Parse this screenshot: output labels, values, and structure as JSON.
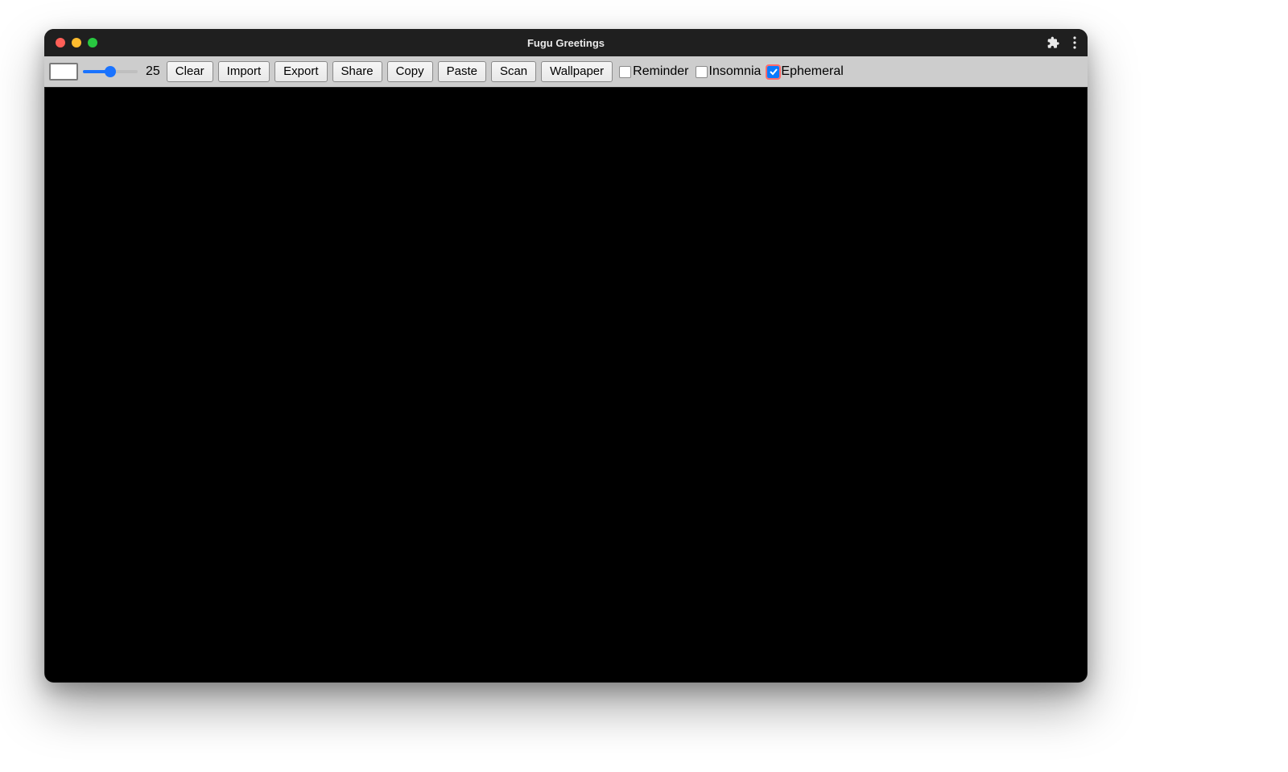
{
  "window": {
    "title": "Fugu Greetings"
  },
  "toolbar": {
    "slider_value": "25",
    "slider_percent": 50,
    "buttons": {
      "clear": "Clear",
      "import": "Import",
      "export": "Export",
      "share": "Share",
      "copy": "Copy",
      "paste": "Paste",
      "scan": "Scan",
      "wallpaper": "Wallpaper"
    },
    "checkboxes": {
      "reminder": {
        "label": "Reminder",
        "checked": false
      },
      "insomnia": {
        "label": "Insomnia",
        "checked": false
      },
      "ephemeral": {
        "label": "Ephemeral",
        "checked": true
      }
    }
  },
  "colors": {
    "accent": "#1a73ff",
    "titlebar": "#1f1f1f",
    "toolbar": "#cdcdcd",
    "canvas": "#000000"
  }
}
